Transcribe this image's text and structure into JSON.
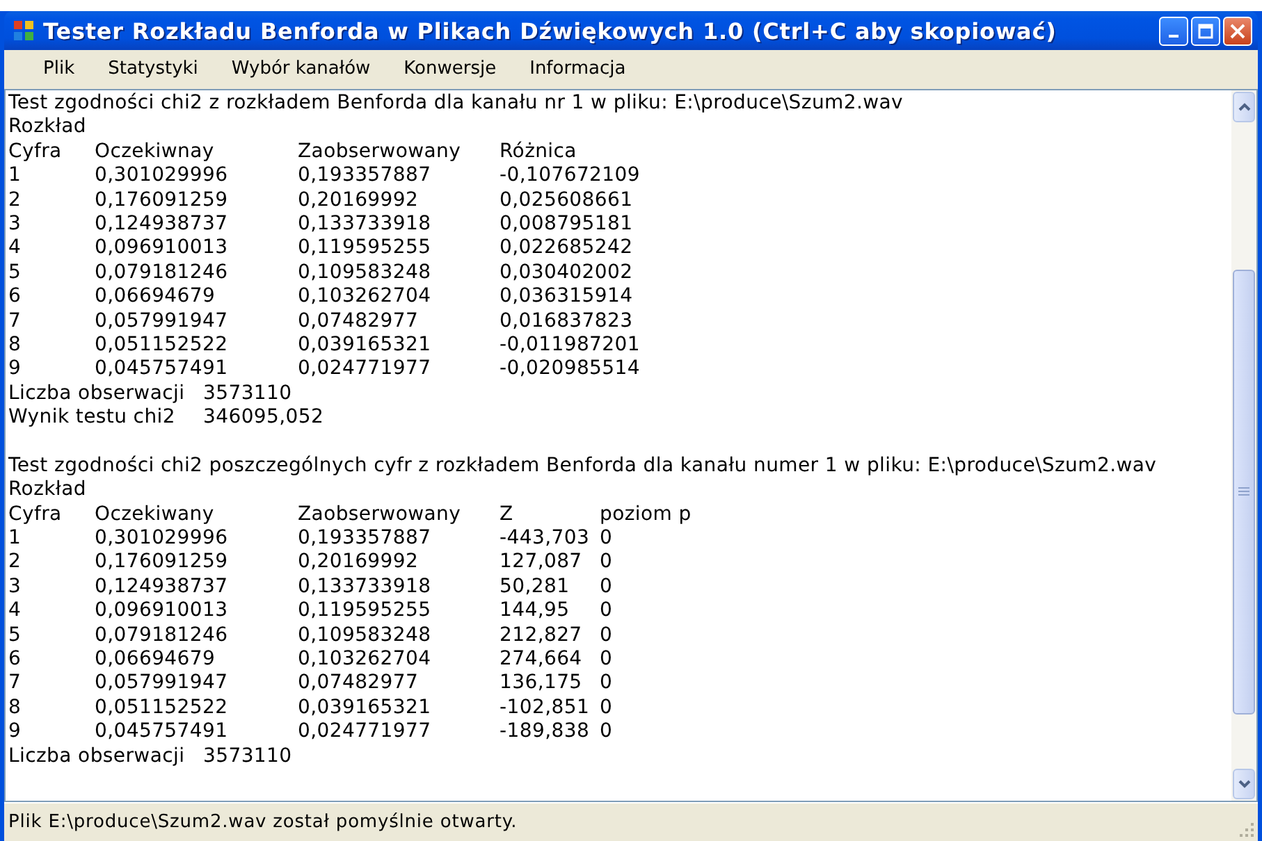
{
  "window": {
    "title": "Tester Rozkładu Benforda w Plikach Dźwiękowych 1.0 (Ctrl+C aby skopiować)"
  },
  "menu": [
    "Plik",
    "Statystyki",
    "Wybór kanałów",
    "Konwersje",
    "Informacja"
  ],
  "sections": [
    {
      "title": "Test zgodności chi2 z rozkładem Benforda dla kanału nr 1 w pliku: E:\\produce\\Szum2.wav",
      "subtitle": "Rozkład",
      "columns": [
        "Cyfra",
        "Oczekiwnay",
        "Zaobserwowany",
        "Różnica"
      ],
      "rows": [
        [
          "1",
          "0,301029996",
          "0,193357887",
          "-0,107672109"
        ],
        [
          "2",
          "0,176091259",
          "0,20169992",
          "0,025608661"
        ],
        [
          "3",
          "0,124938737",
          "0,133733918",
          "0,008795181"
        ],
        [
          "4",
          "0,096910013",
          "0,119595255",
          "0,022685242"
        ],
        [
          "5",
          "0,079181246",
          "0,109583248",
          "0,030402002"
        ],
        [
          "6",
          "0,06694679",
          "0,103262704",
          "0,036315914"
        ],
        [
          "7",
          "0,057991947",
          "0,07482977",
          "0,016837823"
        ],
        [
          "8",
          "0,051152522",
          "0,039165321",
          "-0,011987201"
        ],
        [
          "9",
          "0,045757491",
          "0,024771977",
          "-0,020985514"
        ]
      ],
      "summary": [
        {
          "label": "Liczba obserwacji",
          "value": "3573110"
        },
        {
          "label": "Wynik testu chi2",
          "value": "346095,052"
        }
      ]
    },
    {
      "title": "Test zgodności chi2 poszczególnych cyfr z rozkładem Benforda dla kanału numer 1 w pliku: E:\\produce\\Szum2.wav",
      "subtitle": "Rozkład",
      "columns": [
        "Cyfra",
        "Oczekiwany",
        "Zaobserwowany",
        "Z",
        "poziom p"
      ],
      "rows": [
        [
          "1",
          "0,301029996",
          "0,193357887",
          "-443,703",
          "0"
        ],
        [
          "2",
          "0,176091259",
          "0,20169992",
          "127,087",
          "0"
        ],
        [
          "3",
          "0,124938737",
          "0,133733918",
          "50,281",
          "0"
        ],
        [
          "4",
          "0,096910013",
          "0,119595255",
          "144,95",
          "0"
        ],
        [
          "5",
          "0,079181246",
          "0,109583248",
          "212,827",
          "0"
        ],
        [
          "6",
          "0,06694679",
          "0,103262704",
          "274,664",
          "0"
        ],
        [
          "7",
          "0,057991947",
          "0,07482977",
          "136,175",
          "0"
        ],
        [
          "8",
          "0,051152522",
          "0,039165321",
          "-102,851",
          "0"
        ],
        [
          "9",
          "0,045757491",
          "0,024771977",
          "-189,838",
          "0"
        ]
      ],
      "summary": [
        {
          "label": "Liczba obserwacji",
          "value": "3573110"
        }
      ]
    }
  ],
  "status_bar": {
    "text": "Plik E:\\produce\\Szum2.wav został pomyślnie otwarty."
  }
}
